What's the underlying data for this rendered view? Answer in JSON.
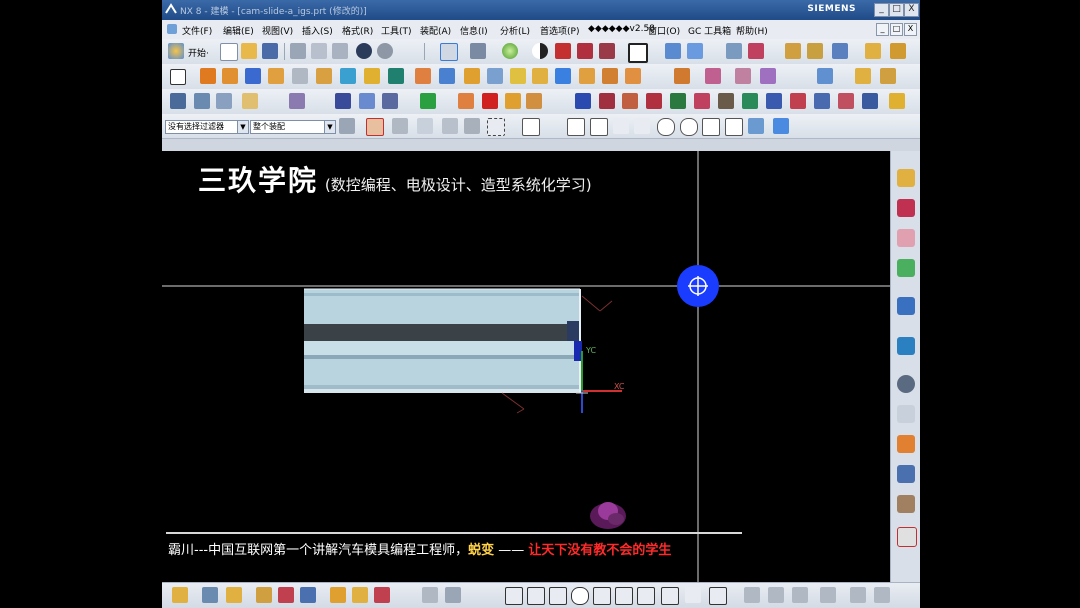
{
  "window": {
    "title": "NX 8 - 建模 - [cam-slide-a_igs.prt (修改的)]",
    "brand": "SIEMENS",
    "controls": {
      "minimize": "_",
      "maximize": "□",
      "close": "X"
    }
  },
  "menu": {
    "items": [
      "文件(F)",
      "编辑(E)",
      "视图(V)",
      "插入(S)",
      "格式(R)",
      "工具(T)",
      "装配(A)",
      "信息(I)",
      "分析(L)",
      "首选项(P)",
      "◆◆◆◆◆◆v2.58",
      "窗口(O)",
      "GC 工具箱",
      "帮助(H)"
    ],
    "doc_controls": {
      "minimize": "_",
      "restore": "□",
      "close": "X"
    }
  },
  "toolbar": {
    "start_label": "开始·",
    "filter_combo": "没有选择过滤器",
    "assembly_combo": "整个装配"
  },
  "banner": {
    "title": "三玖学院",
    "subtitle": "(数控编程、电极设计、造型系统化学习)"
  },
  "footer": {
    "part1": "霸川---中国互联网第一个讲解汽车模具编程工程师，",
    "accent": "蜕变",
    "dash": " —— ",
    "slogan": "让天下没有教不会的学生"
  },
  "axes": {
    "xc": "XC",
    "yc": "YC"
  },
  "colors": {
    "titlebar": "#1f4b88",
    "part_face": "#b9d3df",
    "part_dark": "#3a4248",
    "cursor_blue": "#1a3cff",
    "footer_red": "#ff2a2a",
    "footer_accent": "#ffd24a"
  }
}
